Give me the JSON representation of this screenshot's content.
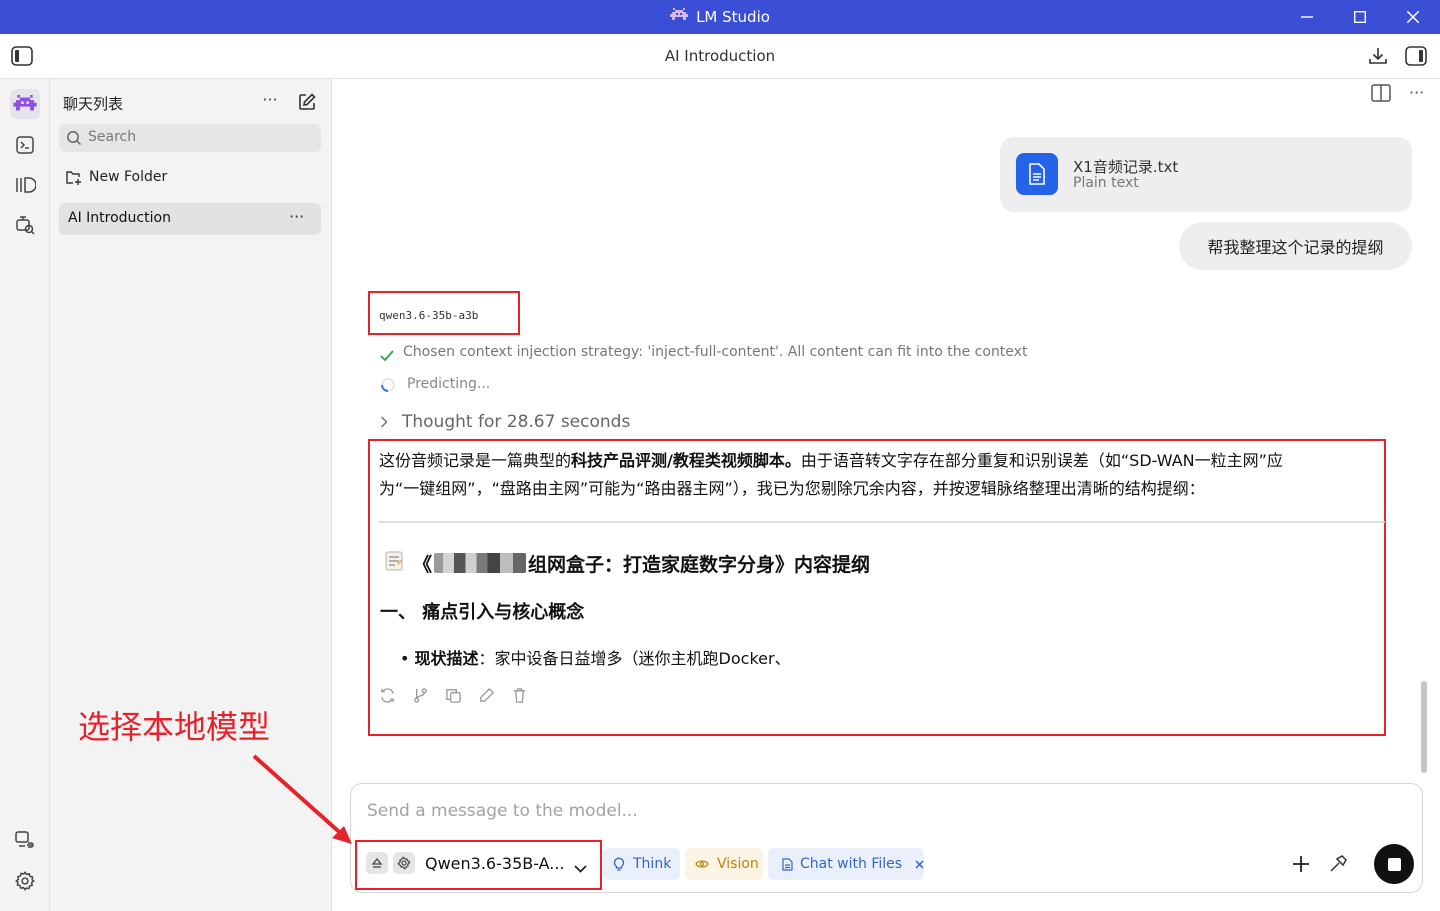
{
  "window": {
    "title": "LM Studio"
  },
  "toolbar": {
    "chat_title": "AI Introduction"
  },
  "sidebar": {
    "header": "聊天列表",
    "search_placeholder": "Search",
    "new_folder": "New Folder",
    "chats": [
      {
        "label": "AI Introduction",
        "selected": true
      }
    ]
  },
  "attachment": {
    "filename": "X1音频记录.txt",
    "type": "Plain text"
  },
  "user_message": "帮我整理这个记录的提纲",
  "response": {
    "model_tag": "qwen3.6-35b-a3b",
    "status_strategy": "Chosen context injection strategy: 'inject-full-content'. All content can fit into the context",
    "status_predicting": "Predicting...",
    "thought": "Thought for 28.67 seconds",
    "intro_pre": "这份音频记录是一篇典型的",
    "intro_bold": "科技产品评测/教程类视频脚本。",
    "intro_line1_post": "由于语音转文字存在部分重复和识别误差（如“SD-WAN一粒主网”应",
    "intro_line2": "为“一键组网”，“盘路由主网”可能为“路由器主网”），我已为您剔除冗余内容，并按逻辑脉络整理出清晰的结构提纲：",
    "heading_open": "《",
    "heading_rest": "组网盒子：打造家庭数字分身》内容提纲",
    "section1": "一、 痛点引入与核心概念",
    "bullet_label": "现状描述",
    "bullet_text": "：家中设备日益增多（迷你主机跑Docker、"
  },
  "annotation": {
    "text": "选择本地模型",
    "color": "#e8222b"
  },
  "composer": {
    "placeholder": "Send a message to the model...",
    "model": "Qwen3.6-35B-A...",
    "chips": {
      "think": "Think",
      "vision": "Vision",
      "files": "Chat with Files"
    }
  },
  "colors": {
    "titlebar": "#3a4fd6",
    "accent": "#2563eb",
    "annotation": "#e8222b"
  }
}
